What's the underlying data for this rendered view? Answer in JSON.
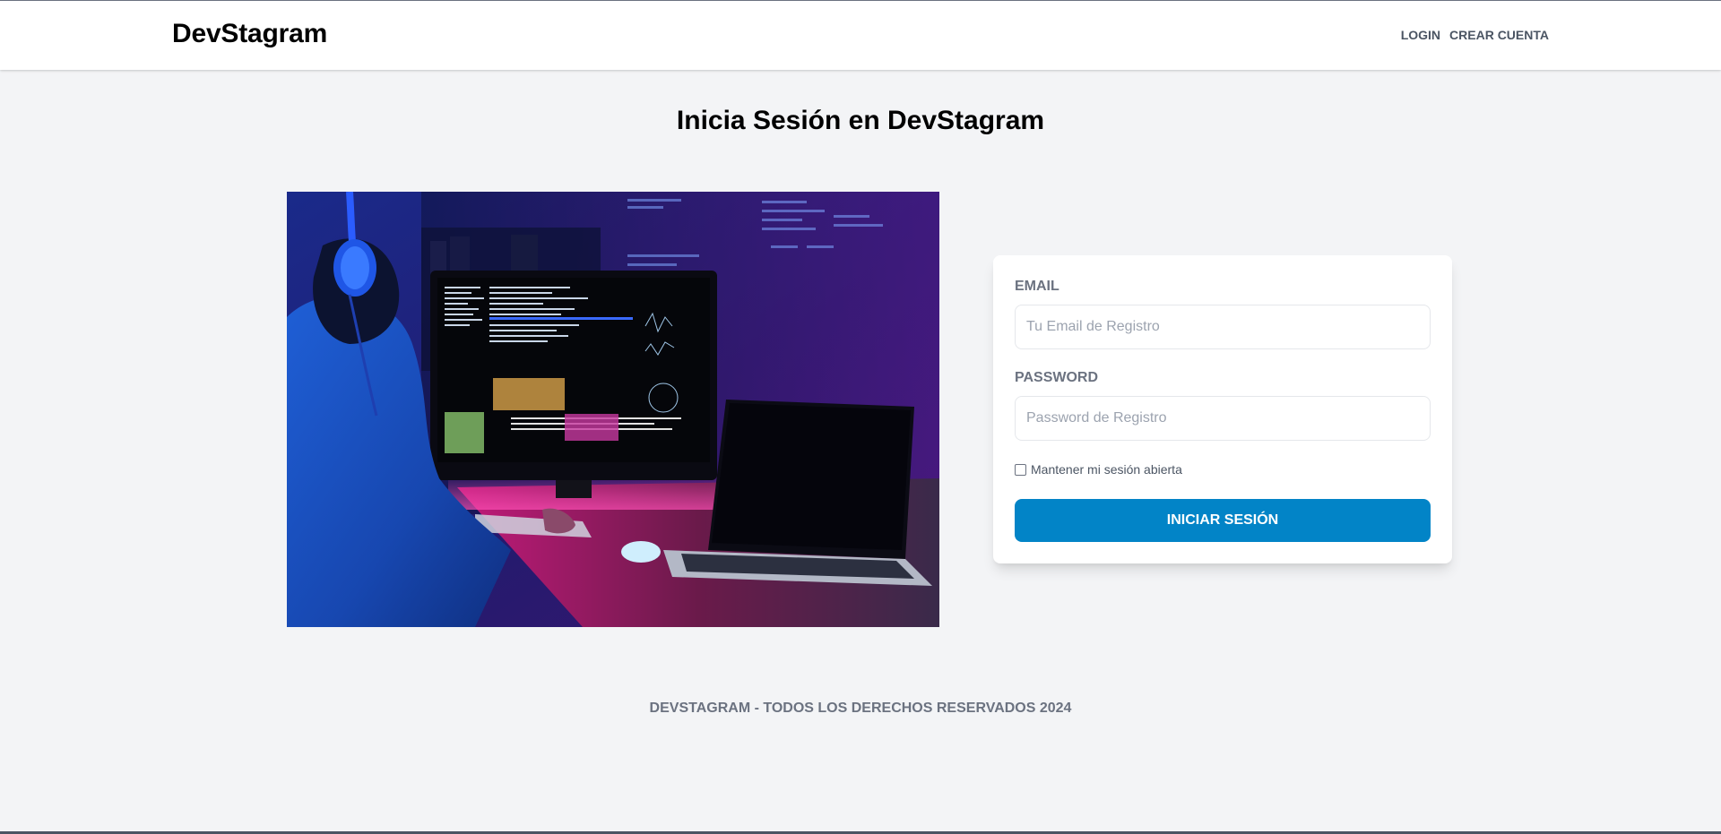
{
  "header": {
    "logo": "DevStagram",
    "nav": {
      "login": "Login",
      "register": "Crear Cuenta"
    }
  },
  "main": {
    "title": "Inicia Sesión en DevStagram",
    "image_alt": "Developer coding at desktop monitor with laptop"
  },
  "form": {
    "email_label": "Email",
    "email_placeholder": "Tu Email de Registro",
    "email_value": "",
    "password_label": "Password",
    "password_placeholder": "Password de Registro",
    "password_value": "",
    "remember_label": "Mantener mi sesión abierta",
    "remember_checked": false,
    "submit_label": "Iniciar Sesión"
  },
  "footer": {
    "text": "DevStagram - Todos los derechos reservados 2024"
  },
  "colors": {
    "accent": "#0284c7",
    "background": "#f3f4f6",
    "muted_text": "#6b7280"
  }
}
